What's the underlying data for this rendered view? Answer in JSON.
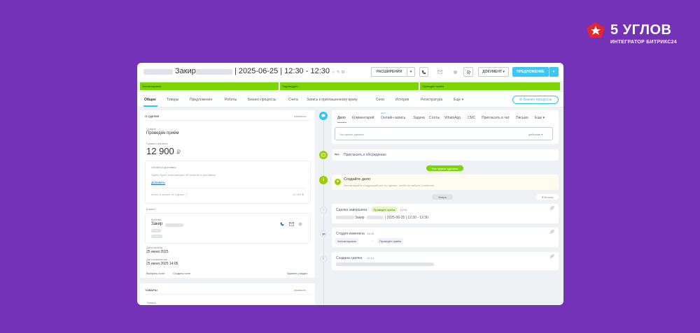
{
  "brand": {
    "title": "5 УГЛОВ",
    "subtitle": "ИНТЕГРАТОР БИТРИКС24",
    "logo_icon": "star-pentagon-logo"
  },
  "titlebar": {
    "name": "Закир",
    "title_rest": "| 2025-06-25 | 12:30 - 12:30",
    "edit_marks": "✓ ✎ ₪ ·",
    "buttons": {
      "extensions": "РАСШИРЕНИЯ",
      "document": "ДОКУМЕНТ",
      "proposal": "ПРЕДЛОЖЕНИЕ"
    },
    "icons": [
      "phone-icon",
      "envelope-icon",
      "circle-icon",
      "gear-icon"
    ]
  },
  "stages": [
    "Запланирован",
    "Подтвердил",
    "Проведён приём"
  ],
  "tabs": [
    "Общее",
    "Товары",
    "Предложения",
    "Роботы",
    "Бизнес-процессы",
    "Счета",
    "Запись к приглашенному врачу",
    "Сеои",
    "История",
    "Регистратура",
    "Еще"
  ],
  "bp_button": "Бизнес-процессы",
  "about": {
    "header": "О СДЕЛКЕ",
    "edit": "изменить",
    "stage_label": "Стадия",
    "stage_value": "Проведён приём",
    "sum_label": "Сумма и валюта",
    "sum_value": "12 900",
    "currency": "₽",
    "payment_title": "Оплата и доставка",
    "payment_hint": "Здесь будет информация об оплатах и доставках",
    "add": "Добавить",
    "total_label": "Итого в оплате по сделке",
    "total_value": "12 900 ₽",
    "client_label": "Клиент",
    "contact_label": "Контакт",
    "contact_name": "Закир",
    "start_label": "Дата начала",
    "start_value": "25 июня 2025",
    "modified_label": "Дата изменения",
    "modified_value": "25 июня 2025 14:05",
    "select_field": "Выбрать поле",
    "create_field": "Создать поле",
    "delete_section": "Удалить раздел"
  },
  "products": {
    "header": "ТОВАРЫ",
    "edit": "изменить",
    "label": "Товары"
  },
  "activity": {
    "tabs": [
      "Дело",
      "Комментарий",
      "Онлайн-запись",
      "Задача",
      "Слоты",
      "WhatsApp",
      "СМС",
      "Пригласить в чат",
      "Письмо",
      "Еще"
    ],
    "new_badge": "NEW",
    "placeholder": "Что нужно сделать",
    "actions": "действия",
    "invite": "Пригласить к обсуждению"
  },
  "timeline": {
    "todo_pill": "Что нужно сделать",
    "create_title": "Создайте дело",
    "create_hint": "Запланируйте следующий шаг по сделке, чтобы не забыть о клиенте",
    "yesterday": "Вчера",
    "filter": "Фильтр",
    "event1_title": "Сделка завершена",
    "event1_badge": "Проведён приём",
    "event1_time": "14:05",
    "event1_text": "Закир",
    "event1_rest": "| 2025-06-25 | 12:30 - 12:30",
    "event2_title": "Стадия изменена",
    "event2_time": "14:05",
    "event2_from": "Запланирован",
    "event2_arrow": "→",
    "event2_to": "Проведён приём",
    "event3_title": "Создана сделка",
    "event3_time": "12:14"
  },
  "colors": {
    "background": "#7432b8",
    "stage_green": "#7bd500",
    "accent_blue": "#3bc8f5"
  }
}
